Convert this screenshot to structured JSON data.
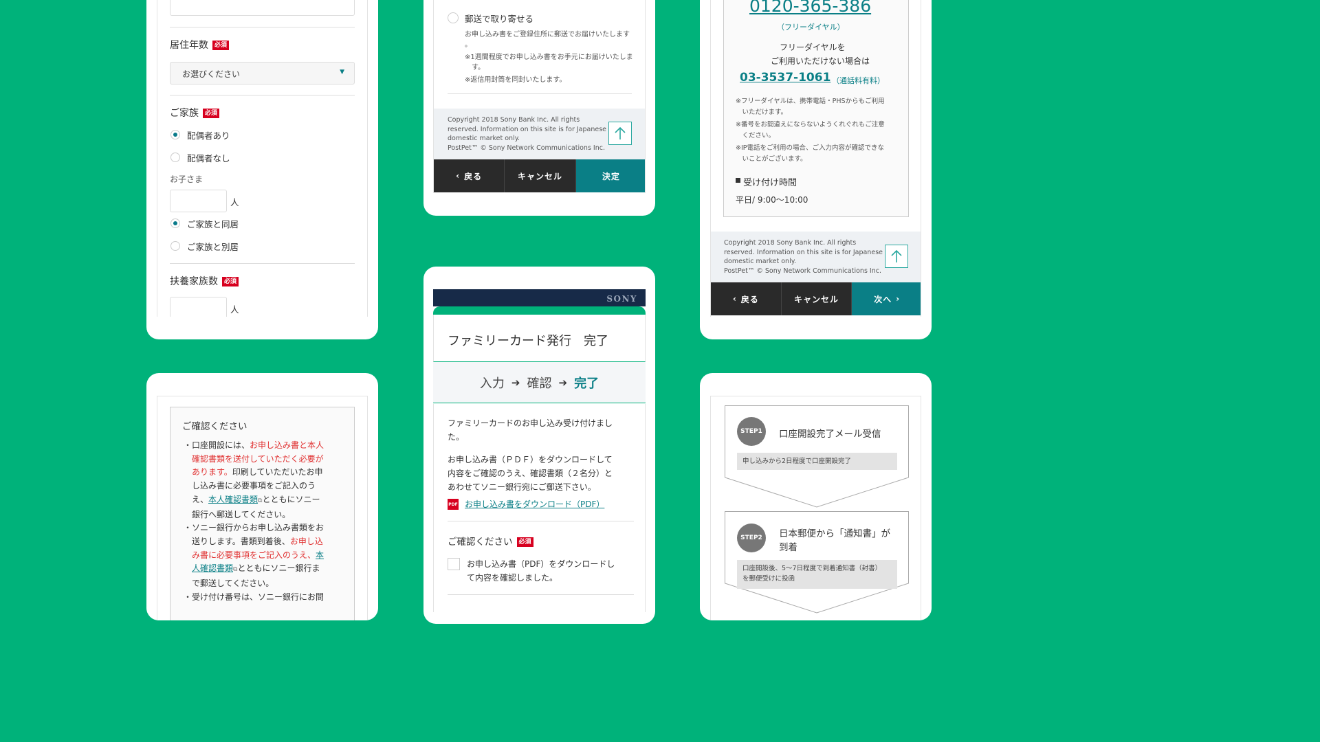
{
  "card1": {
    "residence_label": "居住年数",
    "required": "必須",
    "select_placeholder": "お選びください",
    "family_label": "ご家族",
    "spouse_yes": "配偶者あり",
    "spouse_no": "配偶者なし",
    "children_label": "お子さま",
    "unit_person": "人",
    "live_with": "ご家族と同居",
    "live_apart": "ご家族と別居",
    "dependents_label": "扶養家族数"
  },
  "card2": {
    "mail_option": "郵送で取り寄せる",
    "note1a": "お申し込み書をご登録住所に郵送でお届けいたします",
    "note1b": "。",
    "note2a": "※1週間程度でお申し込み書をお手元にお届けいたしま",
    "note2b": "す。",
    "note3": "※返信用封筒を同封いたします。",
    "copyright": [
      "Copyright 2018 Sony Bank Inc. All rights",
      "reserved. Information on this site is for Japanese",
      "domestic market only.",
      "PostPet™ © Sony Network Communications Inc."
    ],
    "back": "戻る",
    "cancel": "キャンセル",
    "confirm": "決定"
  },
  "card3": {
    "freedial_number": "0120-365-386",
    "freedial_label": "（フリーダイヤル）",
    "info1": "フリーダイヤルを",
    "info2": "ご利用いただけない場合は",
    "paid_number": "03-3537-1061",
    "paid_label": "（通話料有料）",
    "notes": [
      "※フリーダイヤルは、携帯電話・PHSからもご利用",
      "　いただけます。",
      "※番号をお間違えにならないようくれぐれもご注意",
      "　ください。",
      "※IP電話をご利用の場合、ご入力内容が確認できな",
      "　いことがございます。"
    ],
    "hours_heading": "受け付け時間",
    "hours": "平日/ 9:00〜10:00",
    "copyright": [
      "Copyright 2018 Sony Bank Inc. All rights",
      "reserved. Information on this site is for Japanese",
      "domestic market only.",
      "PostPet™ © Sony Network Communications Inc."
    ],
    "back": "戻る",
    "cancel": "キャンセル",
    "next": "次へ"
  },
  "card4": {
    "heading": "ご確認ください",
    "b1": [
      "・口座開設には、",
      "お申し込み書と本人",
      "確認書類を送付していただく必要が",
      "あります。",
      "印刷していただいたお申",
      "し込み書に必要事項をご記入のう",
      "え、",
      "本人確認書類",
      "とともにソニー",
      "銀行へ郵送してください。"
    ],
    "b2": [
      "・ソニー銀行からお申し込み書類をお",
      "送りします。書類到着後、",
      "お申し込",
      "み書に必要事項をご記入のうえ、",
      "本",
      "人確認書類",
      "とともにソニー銀行ま",
      "で郵送してください。"
    ],
    "b3": "・受け付け番号は、ソニー銀行にお問"
  },
  "card5": {
    "brand": "SONY",
    "title": "ファミリーカード発行　完了",
    "steps": [
      "入力",
      "確認",
      "完了"
    ],
    "p1a": "ファミリーカードのお申し込み受け付けまし",
    "p1b": "た。",
    "p2": [
      "お申し込み書（ＰＤＦ）をダウンロードして",
      "内容をご確認のうえ、確認書類（２名分）と",
      "あわせてソニー銀行宛にご郵送下さい。"
    ],
    "pdf_badge": "PDF",
    "download_link": "お申し込み書をダウンロード（PDF）",
    "confirm_heading": "ご確認ください",
    "required": "必須",
    "check_a": "お申し込み書（PDF）をダウンロードし",
    "check_b": "て内容を確認しました。"
  },
  "card6": {
    "step1_badge": "STEP1",
    "step1_title": "口座開設完了メール受信",
    "step1_note": "申し込みから2日程度で口座開設完了",
    "step2_badge": "STEP2",
    "step2_title_a": "日本郵便から「通知書」が",
    "step2_title_b": "到着",
    "step2_note_a": "口座開設後、5〜7日程度で到着通知書（封書）",
    "step2_note_b": "を郵便受けに投函"
  },
  "colors": {
    "background": "#00b27a",
    "accent": "#0a7f86",
    "required": "#d7001f",
    "warning": "#e03030"
  }
}
